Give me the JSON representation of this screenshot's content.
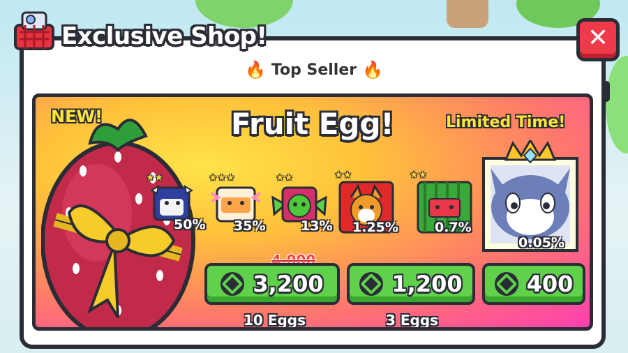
{
  "window": {
    "title": "Exclusive Shop!",
    "close_label": "✕",
    "subtitle": "Top Seller"
  },
  "promo": {
    "new_label": "NEW!",
    "egg_name": "Fruit Egg!",
    "limited_label": "Limited Time!",
    "pets": [
      {
        "icon": "cow-pet-icon",
        "chance": "50%"
      },
      {
        "icon": "axolotl-pet-icon",
        "chance": "35%"
      },
      {
        "icon": "dragon-pet-icon",
        "chance": "13%"
      },
      {
        "icon": "corgi-pet-icon",
        "chance": "1.25%"
      },
      {
        "icon": "watermelon-pet-icon",
        "chance": "0.7%"
      },
      {
        "icon": "crowned-cat-pet-icon",
        "chance": "0.05%"
      }
    ],
    "offers": [
      {
        "old_price": "4,000",
        "price": "3,200",
        "quantity_label": "10 Eggs"
      },
      {
        "price": "1,200",
        "quantity_label": "3 Eggs"
      },
      {
        "price": "400"
      }
    ]
  },
  "colors": {
    "accent_green": "#5fd14a",
    "close_red": "#ef3a4a",
    "outline": "#2a2c36"
  }
}
